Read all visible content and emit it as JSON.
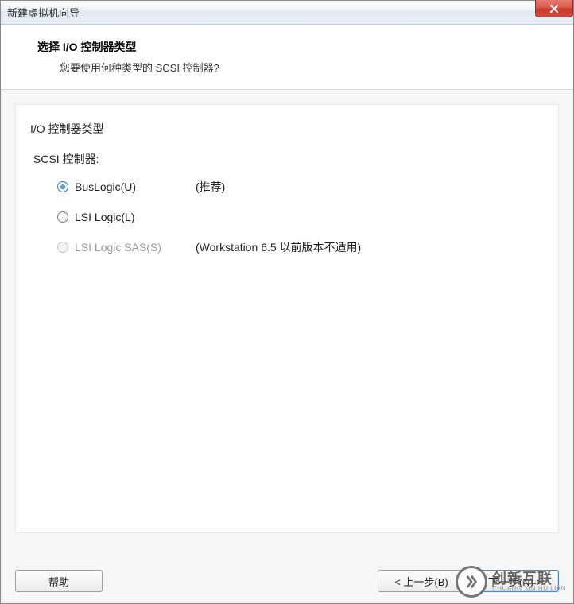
{
  "titlebar": {
    "title": "新建虚拟机向导"
  },
  "header": {
    "title": "选择 I/O 控制器类型",
    "subtitle": "您要使用何种类型的 SCSI 控制器?"
  },
  "content": {
    "section_label": "I/O 控制器类型",
    "group_label": "SCSI 控制器:",
    "options": [
      {
        "label": "BusLogic(U)",
        "note": "(推荐)",
        "checked": true,
        "disabled": false
      },
      {
        "label": "LSI Logic(L)",
        "note": "",
        "checked": false,
        "disabled": false
      },
      {
        "label": "LSI Logic SAS(S)",
        "note": "(Workstation 6.5 以前版本不适用)",
        "checked": false,
        "disabled": true
      }
    ]
  },
  "footer": {
    "help": "帮助",
    "back": "< 上一步(B)",
    "next": "下一步(N) >"
  },
  "watermark": {
    "cn": "创新互联",
    "en": "CHUANG XIN HU LIAN"
  }
}
